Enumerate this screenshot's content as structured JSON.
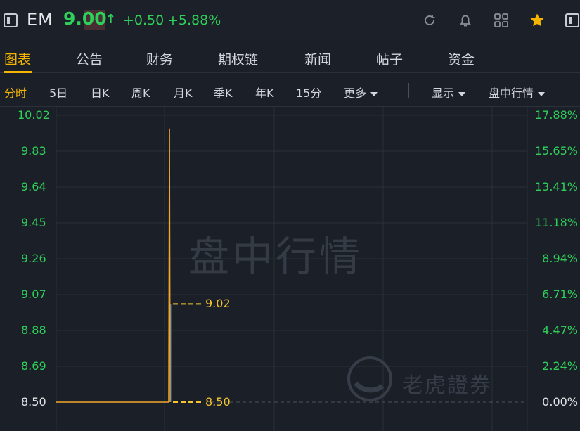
{
  "header": {
    "ticker": "EM",
    "price": "9.00",
    "arrow": "↑",
    "change": "+0.50",
    "change_pct": "+5.88%",
    "up_color": "#2fcf5a",
    "icons": [
      "panel-left-icon",
      "refresh-icon",
      "bell-icon",
      "grid-icon",
      "star-icon",
      "panel-right-icon"
    ]
  },
  "tabs": [
    "图表",
    "公告",
    "财务",
    "期权链",
    "新闻",
    "帖子",
    "资金"
  ],
  "active_tab": "图表",
  "periods": [
    "分时",
    "5日",
    "日K",
    "周K",
    "月K",
    "季K",
    "年K",
    "15分",
    "更多"
  ],
  "active_period": "分时",
  "toolbar": {
    "display_label": "显示",
    "session_label": "盘中行情"
  },
  "watermark": "盘中行情",
  "brand": "老虎證券",
  "chart_data": {
    "type": "line",
    "y_left_ticks": [
      "10.02",
      "9.83",
      "9.64",
      "9.45",
      "9.26",
      "9.07",
      "8.88",
      "8.69",
      "8.50"
    ],
    "y_right_ticks": [
      "17.88%",
      "15.65%",
      "13.41%",
      "11.18%",
      "8.94%",
      "6.71%",
      "4.47%",
      "2.24%",
      "0.00%"
    ],
    "ylim": [
      8.5,
      10.02
    ],
    "prev_close": 8.5,
    "series": [
      {
        "values": [
          8.5,
          8.5,
          9.95,
          8.5
        ],
        "color": "#f4a62a"
      }
    ],
    "annotations": [
      {
        "label": "9.02",
        "value": 9.02
      },
      {
        "label": "8.50",
        "value": 8.5
      }
    ],
    "grid": true
  }
}
